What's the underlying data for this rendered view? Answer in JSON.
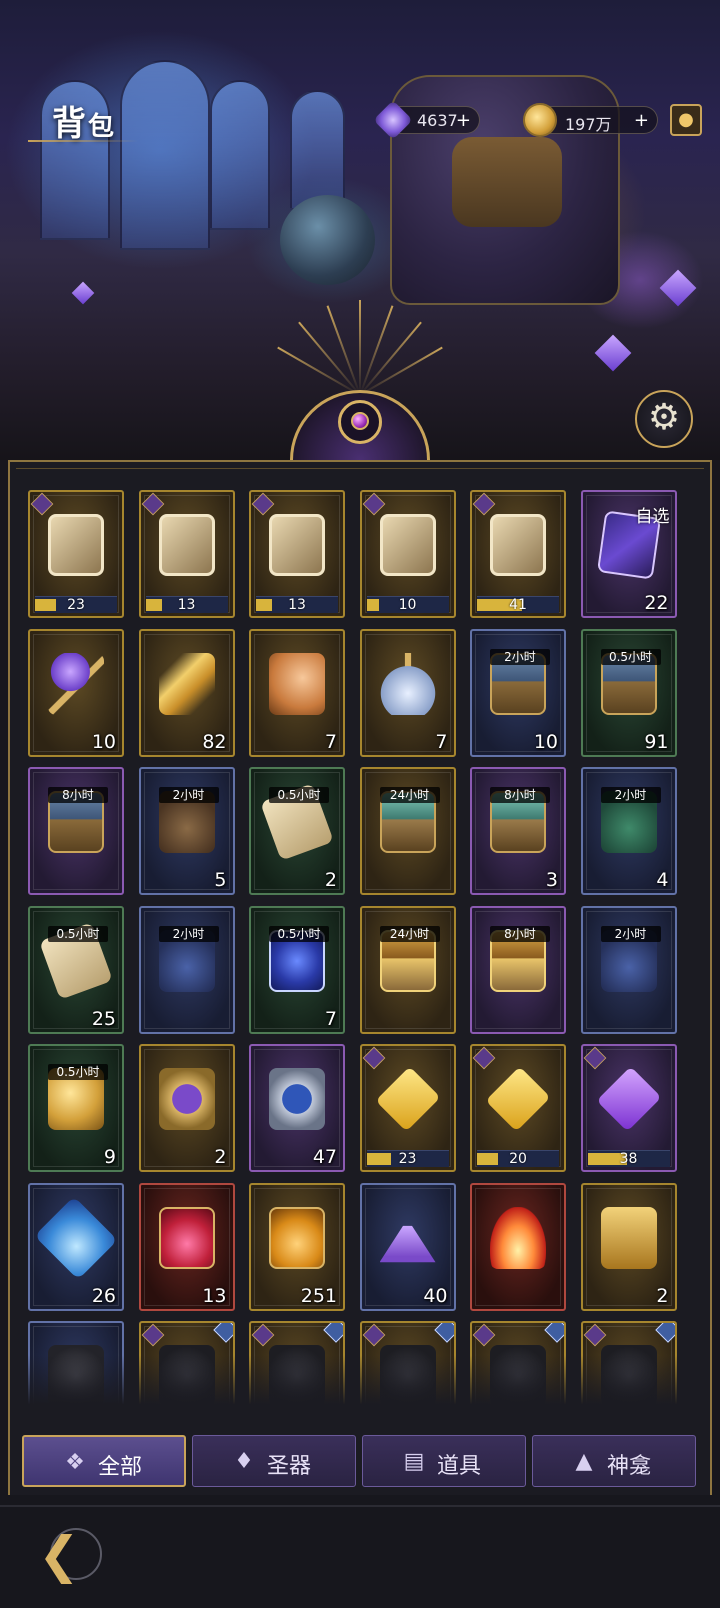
{
  "header": {
    "title_big": "背",
    "title_small": "包",
    "resources": [
      {
        "icon": "star-crystal-icon",
        "value": "4637",
        "plus": "+"
      },
      {
        "icon": "gold-coin-icon",
        "value": "197万",
        "plus": "+"
      }
    ],
    "shop_icon": "money-bag-icon",
    "settings_icon": "gear-icon"
  },
  "inventory": [
    {
      "icon": "puzzle-portrait-white-hair",
      "frame": "gold",
      "fragment": true,
      "progress": 23,
      "fill": 0.25,
      "corner": "star"
    },
    {
      "icon": "puzzle-portrait-lady",
      "frame": "gold",
      "fragment": true,
      "progress": 13,
      "fill": 0.2,
      "corner": "star"
    },
    {
      "icon": "puzzle-portrait-blonde",
      "frame": "gold",
      "fragment": true,
      "progress": 13,
      "fill": 0.2,
      "corner": "star"
    },
    {
      "icon": "puzzle-portrait-dark-hair",
      "frame": "gold",
      "fragment": true,
      "progress": 10,
      "fill": 0.15,
      "corner": "star"
    },
    {
      "icon": "puzzle-portrait-dark",
      "frame": "gold",
      "fragment": true,
      "progress": 41,
      "fill": 0.55,
      "corner": "star"
    },
    {
      "icon": "selectable-card",
      "frame": "purple",
      "pick": "自选",
      "count": "22"
    },
    {
      "icon": "purple-gem-key",
      "frame": "gold",
      "count": "10"
    },
    {
      "icon": "golden-feather",
      "frame": "gold",
      "count": "82"
    },
    {
      "icon": "golden-shell",
      "frame": "gold",
      "count": "7"
    },
    {
      "icon": "crystal-vial",
      "frame": "gold",
      "count": "7"
    },
    {
      "icon": "treasure-chest-blue",
      "frame": "blue",
      "timer": "2小时",
      "count": "10"
    },
    {
      "icon": "treasure-chest-green",
      "frame": "green",
      "timer": "0.5小时",
      "count": "91"
    },
    {
      "icon": "exp-chest",
      "frame": "purple",
      "timer": "8小时",
      "count": ""
    },
    {
      "icon": "exp-coin-bag",
      "frame": "blue",
      "timer": "2小时",
      "count": "5"
    },
    {
      "icon": "exp-scroll",
      "frame": "green",
      "timer": "0.5小时",
      "count": "2"
    },
    {
      "icon": "scroll-chest",
      "frame": "gold",
      "timer": "24小时",
      "count": ""
    },
    {
      "icon": "scroll-chest-teal",
      "frame": "purple",
      "timer": "8小时",
      "count": "3"
    },
    {
      "icon": "scroll-bag-green",
      "frame": "blue",
      "timer": "2小时",
      "count": "4"
    },
    {
      "icon": "scroll-bundle",
      "frame": "green",
      "timer": "0.5小时",
      "count": "25"
    },
    {
      "icon": "exp-bag-blue",
      "frame": "blue",
      "timer": "2小时",
      "count": ""
    },
    {
      "icon": "exp-orbs",
      "frame": "green",
      "timer": "0.5小时",
      "count": "7"
    },
    {
      "icon": "gold-treasure-chest",
      "frame": "gold",
      "timer": "24小时",
      "count": ""
    },
    {
      "icon": "gold-chest-purple",
      "frame": "purple",
      "timer": "8小时",
      "count": ""
    },
    {
      "icon": "coin-bag-blue",
      "frame": "blue",
      "timer": "2小时",
      "count": ""
    },
    {
      "icon": "gold-coin-stack",
      "frame": "green",
      "timer": "0.5小时",
      "count": "9"
    },
    {
      "icon": "purple-medal",
      "frame": "gold",
      "count": "2"
    },
    {
      "icon": "blue-medal",
      "frame": "purple",
      "count": "47"
    },
    {
      "icon": "yellow-crystal-keyhole",
      "frame": "gold",
      "fragment": true,
      "progress": 23,
      "fill": 0.3,
      "corner": "cross"
    },
    {
      "icon": "yellow-crystal-heart",
      "frame": "gold",
      "fragment": true,
      "progress": 20,
      "fill": 0.26,
      "corner": "heart"
    },
    {
      "icon": "purple-crystal-keyhole",
      "frame": "purple",
      "fragment": true,
      "progress": 38,
      "fill": 0.48,
      "corner": "cross"
    },
    {
      "icon": "blue-teardrop-gem",
      "frame": "blue",
      "count": "26"
    },
    {
      "icon": "red-potion-flask",
      "frame": "red",
      "count": "13"
    },
    {
      "icon": "orange-potion-flask",
      "frame": "gold",
      "count": "251"
    },
    {
      "icon": "purple-sand-pile",
      "frame": "blue",
      "count": "40"
    },
    {
      "icon": "fire-essence",
      "frame": "red",
      "count": ""
    },
    {
      "icon": "golden-bell",
      "frame": "gold",
      "count": "2"
    },
    {
      "icon": "stone-urn",
      "frame": "blue",
      "count": ""
    },
    {
      "icon": "artifact-locked-1",
      "frame": "gold",
      "badge": true,
      "corner": "shield"
    },
    {
      "icon": "artifact-locked-2",
      "frame": "gold",
      "badge": true,
      "corner": "heart"
    },
    {
      "icon": "artifact-locked-3",
      "frame": "gold",
      "badge": true,
      "corner": "heart"
    },
    {
      "icon": "artifact-locked-4",
      "frame": "gold",
      "badge": true,
      "corner": "clover"
    },
    {
      "icon": "artifact-locked-5",
      "frame": "gold",
      "badge": true,
      "corner": "star"
    }
  ],
  "tabs": [
    {
      "label": "全部",
      "icon": "all-grid-icon",
      "active": true
    },
    {
      "label": "圣器",
      "icon": "relic-icon",
      "active": false
    },
    {
      "label": "道具",
      "icon": "items-icon",
      "active": false
    },
    {
      "label": "神龛",
      "icon": "shrine-icon",
      "active": false
    }
  ],
  "nav": {
    "back_icon": "back-arrow-icon"
  },
  "colors": {
    "gold_frame": "#a6862e",
    "purple_frame": "#8b5ab2",
    "blue_frame": "#6272a7",
    "green_frame": "#4e7a54",
    "red_frame": "#b0483f",
    "accent": "#c9a45a"
  }
}
